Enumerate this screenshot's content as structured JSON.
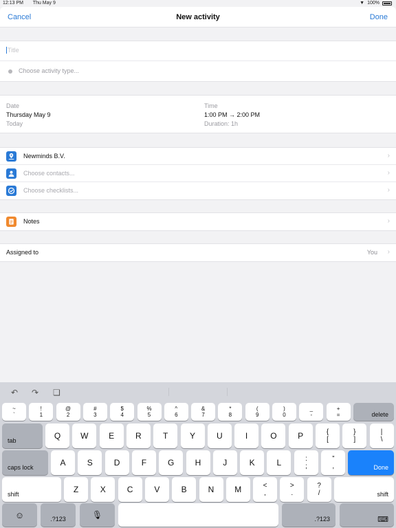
{
  "status": {
    "time": "12:13 PM",
    "date": "Thu May 9",
    "battery": "100%"
  },
  "nav": {
    "cancel": "Cancel",
    "title": "New activity",
    "done": "Done"
  },
  "form": {
    "title_placeholder": "Title",
    "activity_type_placeholder": "Choose activity type...",
    "date": {
      "label": "Date",
      "value": "Thursday May 9",
      "sub": "Today"
    },
    "time": {
      "label": "Time",
      "value": "1:00 PM → 2:00 PM",
      "sub": "Duration: 1h"
    },
    "organization": {
      "label": "Newminds B.V.",
      "icon": "building-pin-icon",
      "color": "#2a7ad6"
    },
    "contacts": {
      "label": "Choose contacts...",
      "icon": "person-icon",
      "color": "#2a7ad6"
    },
    "checklists": {
      "label": "Choose checklists...",
      "icon": "checklist-icon",
      "color": "#2a7ad6"
    },
    "notes": {
      "label": "Notes",
      "icon": "notes-icon",
      "color": "#f0892e"
    },
    "assigned": {
      "label": "Assigned to",
      "value": "You"
    }
  },
  "keyboard": {
    "toolbar": [
      "undo-icon",
      "redo-icon",
      "paste-icon"
    ],
    "numrow": [
      {
        "top": "~",
        "bottom": "`"
      },
      {
        "top": "!",
        "bottom": "1"
      },
      {
        "top": "@",
        "bottom": "2"
      },
      {
        "top": "#",
        "bottom": "3"
      },
      {
        "top": "$",
        "bottom": "4"
      },
      {
        "top": "%",
        "bottom": "5"
      },
      {
        "top": "^",
        "bottom": "6"
      },
      {
        "top": "&",
        "bottom": "7"
      },
      {
        "top": "*",
        "bottom": "8"
      },
      {
        "top": "(",
        "bottom": "9"
      },
      {
        "top": ")",
        "bottom": "0"
      },
      {
        "top": "_",
        "bottom": "-"
      },
      {
        "top": "+",
        "bottom": "="
      }
    ],
    "delete": "delete",
    "tab": "tab",
    "row1": [
      "Q",
      "W",
      "E",
      "R",
      "T",
      "Y",
      "U",
      "I",
      "O",
      "P"
    ],
    "row1_extra": [
      {
        "top": "{",
        "bottom": "["
      },
      {
        "top": "}",
        "bottom": "]"
      },
      {
        "top": "|",
        "bottom": "\\"
      }
    ],
    "caps": "caps lock",
    "row2": [
      "A",
      "S",
      "D",
      "F",
      "G",
      "H",
      "J",
      "K",
      "L"
    ],
    "row2_extra": [
      {
        "top": ":",
        "bottom": ";"
      },
      {
        "top": "”",
        "bottom": ","
      }
    ],
    "done": "Done",
    "shift": "shift",
    "row3": [
      "Z",
      "X",
      "C",
      "V",
      "B",
      "N",
      "M"
    ],
    "row3_extra": [
      {
        "top": "<",
        "bottom": ","
      },
      {
        "top": ">",
        "bottom": "."
      },
      {
        "top": "?",
        "bottom": "/"
      }
    ],
    "numbers": ".?123",
    "emoji_icon": "emoji-icon",
    "mic_icon": "microphone-icon",
    "hide_icon": "keyboard-hide-icon"
  }
}
